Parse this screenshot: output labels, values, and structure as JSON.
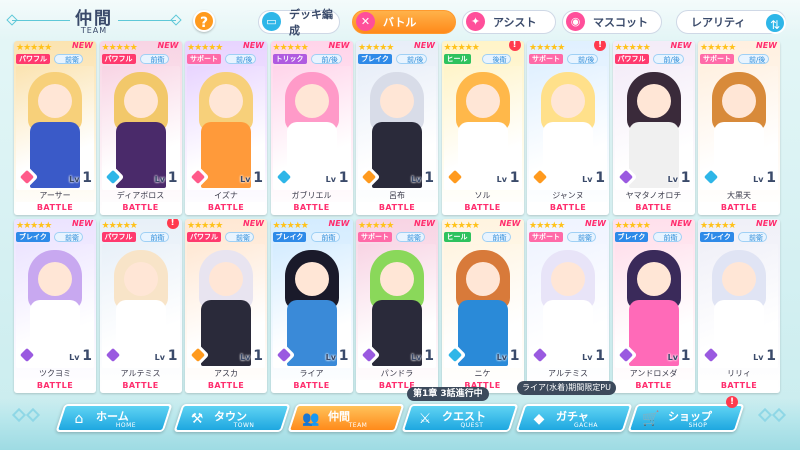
{
  "header": {
    "title": "仲間",
    "subtitle": "TEAM",
    "help_label": "?",
    "tabs": [
      {
        "label": "デッキ編成",
        "icon": "deck-icon",
        "active": false,
        "icon_color": "#2eb6e8",
        "glyph": "▭"
      },
      {
        "label": "バトル",
        "icon": "battle-icon",
        "active": true,
        "icon_color": "#ff4f9a",
        "glyph": "✕"
      },
      {
        "label": "アシスト",
        "icon": "assist-icon",
        "active": false,
        "icon_color": "#ff4f9a",
        "glyph": "✦"
      },
      {
        "label": "マスコット",
        "icon": "mascot-icon",
        "active": false,
        "icon_color": "#ff4f9a",
        "glyph": "◉"
      },
      {
        "label": "レアリティ",
        "icon": "sort-icon",
        "active": false,
        "icon_color": "#2eb6e8",
        "glyph": "⇅"
      }
    ]
  },
  "colors": {
    "accent_orange": "#ff8a1a",
    "accent_blue": "#1ea7e0",
    "new_pink": "#ff2e6e",
    "role_power": "#ff3a6e",
    "role_support": "#ff6aa8",
    "role_trick": "#b05ae0",
    "role_break": "#2e8ae8",
    "role_heal": "#2ec25e"
  },
  "cards": [
    {
      "name": "アーサー",
      "role": "パワフル",
      "position": "前衛",
      "level": "1",
      "badge": "NEW",
      "element": "diamond",
      "art": [
        "#f7d07a",
        "#3a5ac8",
        "#fbe3b0"
      ]
    },
    {
      "name": "ディアボロス",
      "role": "パワフル",
      "position": "前衛",
      "level": "1",
      "badge": "NEW",
      "element": "snow",
      "art": [
        "#f2c86a",
        "#4a2a6a",
        "#f8d4e4"
      ]
    },
    {
      "name": "イズナ",
      "role": "サポート",
      "position": "前/後",
      "level": "1",
      "badge": "NEW",
      "element": "diamond",
      "art": [
        "#f7d07a",
        "#ff9a3a",
        "#e8d4ff"
      ]
    },
    {
      "name": "ガブリエル",
      "role": "トリック",
      "position": "前/後",
      "level": "1",
      "badge": "NEW",
      "element": "snow",
      "art": [
        "#ff9ac8",
        "#ffffff",
        "#ffd4ea"
      ]
    },
    {
      "name": "呂布",
      "role": "ブレイク",
      "position": "前/後",
      "level": "1",
      "badge": "NEW",
      "element": "sun",
      "art": [
        "#d8dce8",
        "#2a2a3a",
        "#e8eef8"
      ]
    },
    {
      "name": "ソル",
      "role": "ヒール",
      "position": "後衛",
      "level": "1",
      "badge": "!",
      "element": "sun",
      "art": [
        "#ffb84a",
        "#ffffff",
        "#fff4c8"
      ]
    },
    {
      "name": "ジャンヌ",
      "role": "サポート",
      "position": "前/後",
      "level": "1",
      "badge": "!",
      "element": "sun",
      "art": [
        "#ffe08a",
        "#ffffff",
        "#e0f0ff"
      ]
    },
    {
      "name": "ヤマタノオロチ",
      "role": "パワフル",
      "position": "前/後",
      "level": "1",
      "badge": "NEW",
      "element": "moon",
      "art": [
        "#3a2a3a",
        "#f0f0f0",
        "#f4ecf8"
      ]
    },
    {
      "name": "大黒天",
      "role": "サポート",
      "position": "前/後",
      "level": "1",
      "badge": "NEW",
      "element": "snow",
      "art": [
        "#d88a3a",
        "#ffffff",
        "#fff0e0"
      ]
    },
    {
      "name": "ツクヨミ",
      "role": "ブレイク",
      "position": "前衛",
      "level": "1",
      "badge": "NEW",
      "element": "moon",
      "art": [
        "#c8a8f0",
        "#ffffff",
        "#ece4ff"
      ]
    },
    {
      "name": "アルテミス",
      "role": "パワフル",
      "position": "前衛",
      "level": "1",
      "badge": "!",
      "element": "moon",
      "art": [
        "#f8e4c8",
        "#ffffff",
        "#e8f0f8"
      ]
    },
    {
      "name": "アスカ",
      "role": "パワフル",
      "position": "前衛",
      "level": "1",
      "badge": "NEW",
      "element": "sun",
      "art": [
        "#e8e4f0",
        "#2a2a3a",
        "#ffe8d4"
      ]
    },
    {
      "name": "ライア",
      "role": "ブレイク",
      "position": "前衛",
      "level": "1",
      "badge": "NEW",
      "element": "moon",
      "art": [
        "#1a1a2a",
        "#3a8ad8",
        "#d4ecff"
      ]
    },
    {
      "name": "パンドラ",
      "role": "サポート",
      "position": "前衛",
      "level": "1",
      "badge": "NEW",
      "element": "moon",
      "art": [
        "#8ad85a",
        "#2a2a3a",
        "#f8d4e4"
      ]
    },
    {
      "name": "ニケ",
      "role": "ヒール",
      "position": "前衛",
      "level": "1",
      "badge": "NEW",
      "element": "snow",
      "art": [
        "#d87a3a",
        "#2a8ad8",
        "#fff4e0"
      ]
    },
    {
      "name": "アルテミス",
      "role": "サポート",
      "position": "前衛",
      "level": "1",
      "badge": "NEW",
      "element": "moon",
      "art": [
        "#e8e4f8",
        "#ffffff",
        "#f0f4ff"
      ]
    },
    {
      "name": "アンドロメダ",
      "role": "ブレイク",
      "position": "前衛",
      "level": "1",
      "badge": "NEW",
      "element": "moon",
      "art": [
        "#3a2a5a",
        "#ff6ab8",
        "#ffe0ec"
      ]
    },
    {
      "name": "リリィ",
      "role": "ブレイク",
      "position": "前衛",
      "level": "1",
      "badge": "NEW",
      "element": "moon",
      "art": [
        "#e0e4f4",
        "#ffffff",
        "#f0f0f8"
      ]
    }
  ],
  "card_footer": "BATTLE",
  "level_prefix": "Lv",
  "rarity_stars": "★★★★★",
  "bottom_nav": [
    {
      "label": "ホーム",
      "sub": "HOME",
      "icon": "home-icon",
      "glyph": "⌂",
      "active": false
    },
    {
      "label": "タウン",
      "sub": "TOWN",
      "icon": "town-icon",
      "glyph": "⚒",
      "active": false
    },
    {
      "label": "仲間",
      "sub": "TEAM",
      "icon": "team-icon",
      "glyph": "👥",
      "active": true
    },
    {
      "label": "クエスト",
      "sub": "QUEST",
      "icon": "quest-icon",
      "glyph": "⚔",
      "active": false
    },
    {
      "label": "ガチャ",
      "sub": "GACHA",
      "icon": "gacha-icon",
      "glyph": "◆",
      "active": false
    },
    {
      "label": "ショップ",
      "sub": "SHOP",
      "icon": "cart-icon",
      "glyph": "🛒",
      "active": false
    }
  ],
  "quest_note": "第1章 3話進行中",
  "gacha_note": "ライア(水着)期間限定PU",
  "shop_badge": "!"
}
